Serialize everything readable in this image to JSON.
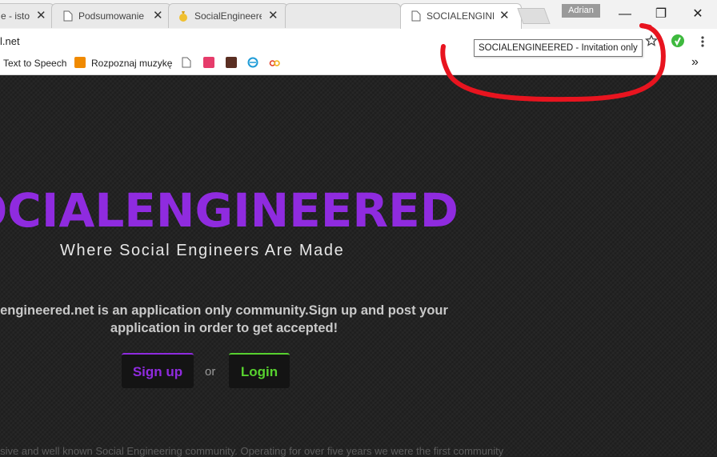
{
  "tabs": [
    {
      "title": "e - isto",
      "active": false
    },
    {
      "title": "Podsumowanie",
      "active": false
    },
    {
      "title": "SocialEngineered",
      "active": false
    },
    {
      "title": "",
      "active": false
    },
    {
      "title": "SOCIALENGINEERED",
      "active": true
    }
  ],
  "tab_close_glyph": "✕",
  "profile_name": "Adrian",
  "window_controls": {
    "minimize": "—",
    "restore": "❐",
    "close": "✕"
  },
  "address_bar": {
    "url": "l.net"
  },
  "tooltip": "SOCIALENGINEERED - Invitation only",
  "bookmarks": [
    {
      "label": "Text to Speech",
      "icon": "none"
    },
    {
      "label": "Rozpoznaj muzykę",
      "icon": "shazam-icon"
    },
    {
      "label": "",
      "icon": "page-icon"
    },
    {
      "label": "",
      "icon": "gg-icon"
    },
    {
      "label": "",
      "icon": "image-icon"
    },
    {
      "label": "",
      "icon": "e-icon"
    },
    {
      "label": "",
      "icon": "oo-icon"
    }
  ],
  "bookmarks_overflow": "»",
  "page": {
    "title": "OCIALENGINEERED",
    "subtitle": "Where Social Engineers Are Made",
    "intro_line1": "engineered.net is an application only community.Sign up and post your",
    "intro_line2": "application in order to get accepted!",
    "signup_label": "Sign up",
    "or_label": "or",
    "login_label": "Login",
    "footer": "lusive and well known Social Engineering community. Operating for over five years we were the first community"
  },
  "colors": {
    "brand_purple": "#8f2bdf",
    "login_green": "#57d12f",
    "annotation_red": "#e8141f"
  }
}
